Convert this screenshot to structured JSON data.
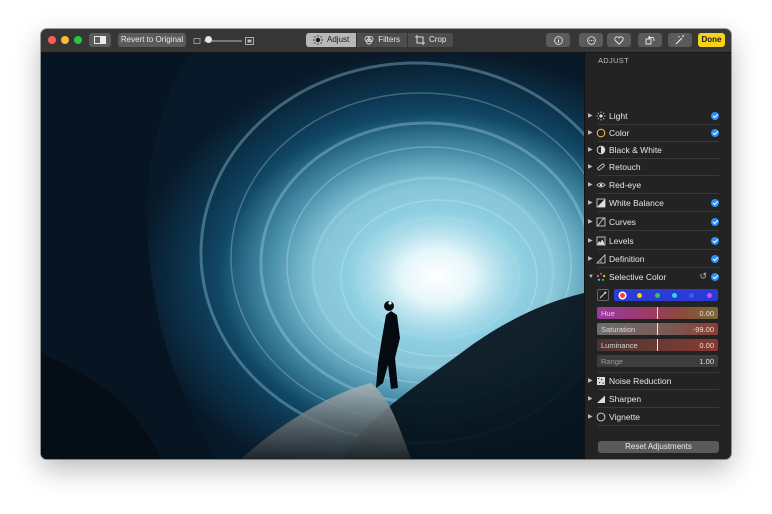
{
  "toolbar": {
    "revert_label": "Revert to Original",
    "tabs": [
      {
        "label": "Adjust",
        "icon": "sun-icon",
        "active": true
      },
      {
        "label": "Filters",
        "icon": "filters-icon",
        "active": false
      },
      {
        "label": "Crop",
        "icon": "crop-icon",
        "active": false
      }
    ],
    "done_label": "Done",
    "zoom_level": 0.1,
    "colors": {
      "done": "#f7d21b",
      "active_tab": "#b8b8b8"
    }
  },
  "panel": {
    "title": "ADJUST",
    "items": [
      {
        "label": "Light",
        "icon": "light-icon",
        "checked": true
      },
      {
        "label": "Color",
        "icon": "color-icon",
        "checked": true
      },
      {
        "label": "Black & White",
        "icon": "black-white-icon",
        "checked": false
      },
      {
        "label": "Retouch",
        "icon": "retouch-icon",
        "checked": false
      },
      {
        "label": "Red-eye",
        "icon": "red-eye-icon",
        "checked": false
      },
      {
        "label": "White Balance",
        "icon": "white-balance-icon",
        "checked": true
      },
      {
        "label": "Curves",
        "icon": "curves-icon",
        "checked": true
      },
      {
        "label": "Levels",
        "icon": "levels-icon",
        "checked": true
      },
      {
        "label": "Definition",
        "icon": "definition-icon",
        "checked": true
      },
      {
        "label": "Selective Color",
        "icon": "selective-color-icon",
        "checked": true,
        "expanded": true
      }
    ],
    "selective_color": {
      "swatches": [
        "#ff3b30",
        "#ffcc00",
        "#34c759",
        "#33d6e6",
        "#3a5bff",
        "#d14bff"
      ],
      "selected_swatch": 0,
      "sliders": [
        {
          "label": "Hue",
          "value": "0.00"
        },
        {
          "label": "Saturation",
          "value": "-99.00"
        },
        {
          "label": "Luminance",
          "value": "0.00"
        },
        {
          "label": "Range",
          "value": "1.00"
        }
      ]
    },
    "bottom_items": [
      {
        "label": "Noise Reduction",
        "icon": "noise-reduction-icon"
      },
      {
        "label": "Sharpen",
        "icon": "sharpen-icon"
      },
      {
        "label": "Vignette",
        "icon": "vignette-icon"
      }
    ],
    "reset_label": "Reset Adjustments",
    "check_color": "#2f8cf5"
  }
}
